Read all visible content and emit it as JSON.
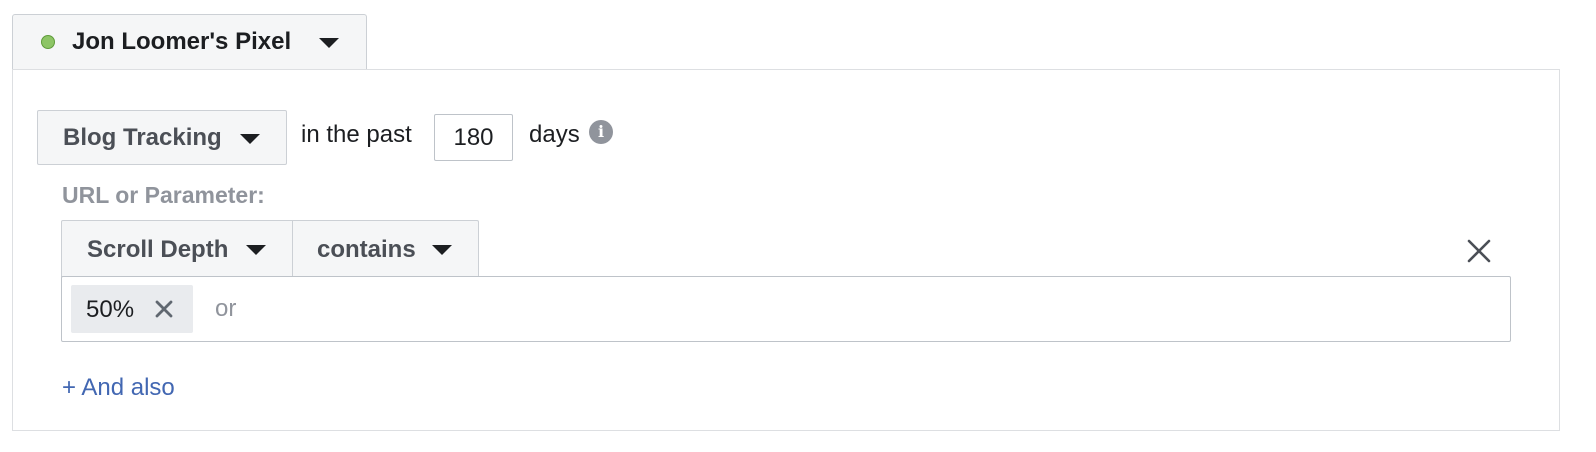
{
  "pixel_selector": {
    "name": "Jon Loomer's Pixel",
    "status_color": "#8dc566",
    "icon": "chevron-down-icon"
  },
  "event_rule": {
    "event_label": "Blog Tracking",
    "in_the_past_text": "in the past",
    "days_value": "180",
    "days_label": "days",
    "info_icon": "info-icon",
    "info_glyph": "i"
  },
  "url_filter": {
    "label": "URL or Parameter:",
    "field_label": "Scroll Depth",
    "operator_label": "contains",
    "tokens": [
      "50%"
    ],
    "input_placeholder": "or",
    "remove_icon": "close-icon"
  },
  "and_also_link": "+ And also",
  "colors": {
    "link": "#4267b2",
    "muted_text": "#90949c",
    "dropdown_bg": "#f5f6f7",
    "token_bg": "#e9ebee"
  }
}
